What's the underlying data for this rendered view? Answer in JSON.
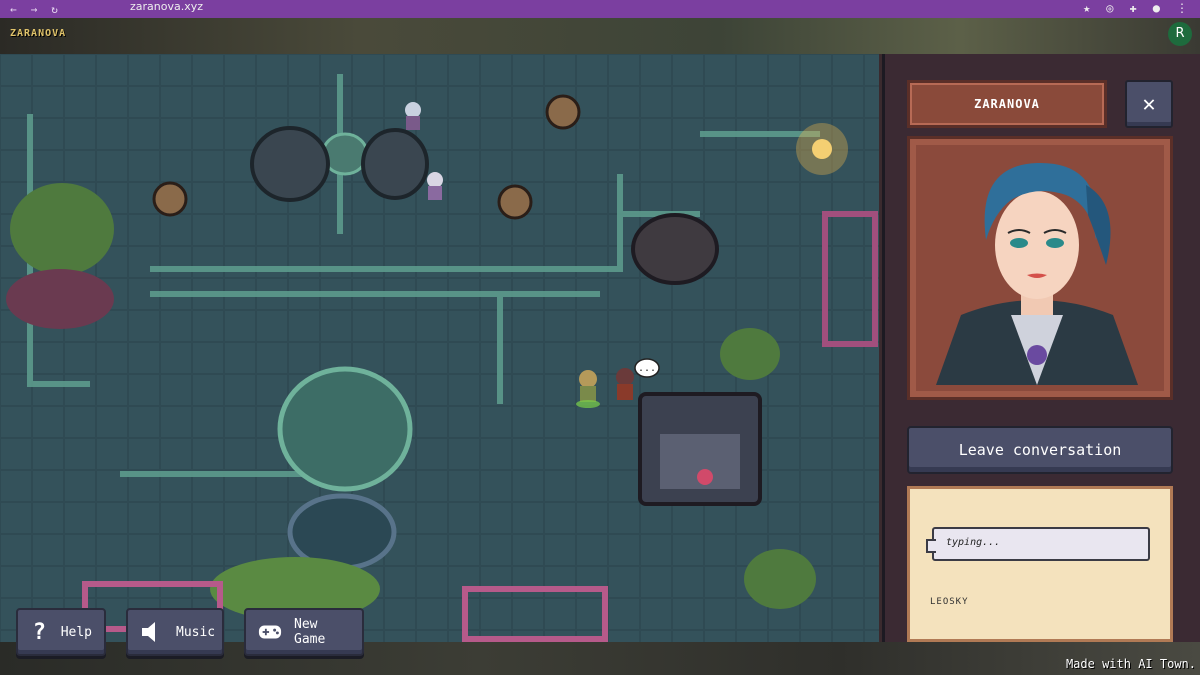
{
  "browser": {
    "url": "zaranova.xyz"
  },
  "app": {
    "logo": "ZARANOVA",
    "user_initial": "R"
  },
  "sidebar": {
    "character_name": "ZARANOVA",
    "close_icon": "close-icon",
    "leave_label": "Leave conversation",
    "chat": {
      "message": "typing...",
      "speaker": "LEOSKY"
    }
  },
  "controls": {
    "help_label": "Help",
    "music_label": "Music",
    "new_game_label": "New Game",
    "help_icon": "question-icon",
    "music_icon": "speaker-icon",
    "new_game_icon": "gamepad-icon"
  },
  "footer": {
    "credit": "Made with AI Town."
  },
  "map": {
    "speech_bubble": "..."
  }
}
